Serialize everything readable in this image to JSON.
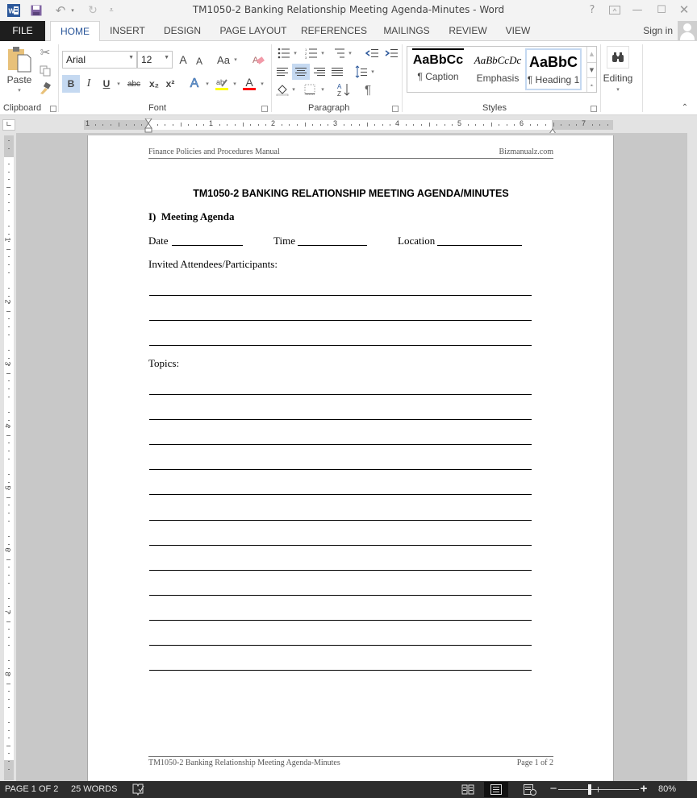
{
  "window": {
    "title": "TM1050-2 Banking Relationship Meeting Agenda-Minutes - Word",
    "quick_access": {
      "app_icon": "word-icon",
      "save": "save-icon",
      "undo": "undo-icon",
      "redo": "redo-icon",
      "customize": "customize-qat-icon"
    },
    "controls": {
      "help": "?",
      "ribbon_display": "ribbon-display-icon",
      "minimize": "—",
      "maximize": "☐",
      "close": "✕"
    }
  },
  "tabs": [
    {
      "label": "FILE"
    },
    {
      "label": "HOME"
    },
    {
      "label": "INSERT"
    },
    {
      "label": "DESIGN"
    },
    {
      "label": "PAGE LAYOUT"
    },
    {
      "label": "REFERENCES"
    },
    {
      "label": "MAILINGS"
    },
    {
      "label": "REVIEW"
    },
    {
      "label": "VIEW"
    }
  ],
  "active_tab": "HOME",
  "account": {
    "sign_in": "Sign in"
  },
  "ribbon": {
    "clipboard": {
      "label": "Clipboard",
      "paste": "Paste"
    },
    "font": {
      "label": "Font",
      "font_name": "Arial",
      "font_size": "12",
      "grow": "A",
      "shrink": "A",
      "change_case": "Aa",
      "bold": "B",
      "italic": "I",
      "underline": "U",
      "strikethrough": "abc",
      "subscript": "x₂",
      "superscript": "x²",
      "text_effects": "A",
      "font_color": "A",
      "highlight_color": "#ffff00",
      "font_color_value": "#ff0000"
    },
    "paragraph": {
      "label": "Paragraph",
      "show_marks": "¶"
    },
    "styles": {
      "label": "Styles",
      "items": [
        {
          "sample": "AaBbCc",
          "name": "¶ Caption"
        },
        {
          "sample": "AaBbCcDc",
          "name": "Emphasis"
        },
        {
          "sample": "AaBbC",
          "name": "¶ Heading 1"
        }
      ]
    },
    "editing": {
      "label": "Editing"
    }
  },
  "ruler": {
    "horizontal_numbers": [
      "1",
      "1",
      "2",
      "3",
      "4",
      "5",
      "6",
      "7"
    ],
    "vertical_numbers": [
      "1",
      "1",
      "2",
      "3",
      "4",
      "5",
      "6",
      "7",
      "8"
    ]
  },
  "document": {
    "header_left": "Finance Policies and Procedures Manual",
    "header_right": "Bizmanualz.com",
    "title": "TM1050-2 BANKING RELATIONSHIP MEETING AGENDA/MINUTES",
    "section_heading": "I)  Meeting Agenda",
    "date_label": "Date",
    "time_label": "Time",
    "location_label": "Location",
    "attendees_label": "Invited Attendees/Participants:",
    "attendee_lines": 3,
    "topics_label": "Topics:",
    "topic_lines": 12,
    "footer_left": "TM1050-2 Banking Relationship Meeting Agenda-Minutes",
    "footer_right": "Page 1 of 2"
  },
  "status": {
    "page": "PAGE 1 OF 2",
    "words": "25 WORDS",
    "proofing_icon": "proofing-icon",
    "zoom": "80%",
    "zoom_value_percent": 80,
    "active_view": "Print Layout"
  }
}
